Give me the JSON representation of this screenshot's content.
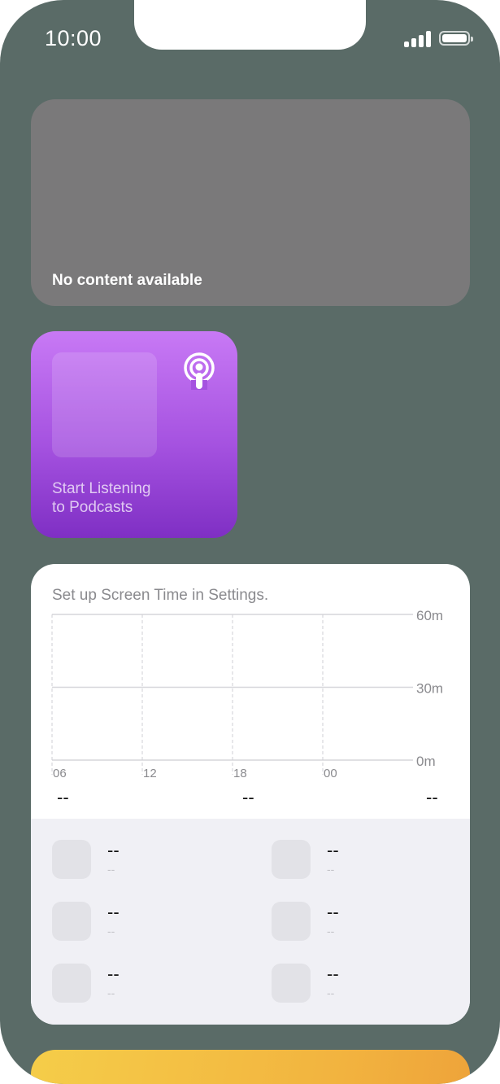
{
  "status_bar": {
    "time": "10:00"
  },
  "widgets": {
    "empty": {
      "message": "No content available"
    },
    "podcasts": {
      "line1": "Start Listening",
      "line2": "to Podcasts",
      "icon": "podcasts-icon"
    },
    "screen_time": {
      "hint": "Set up Screen Time in Settings.",
      "chart_data": {
        "type": "bar",
        "categories": [
          "06",
          "12",
          "18",
          "00"
        ],
        "values": [],
        "y_ticks": [
          "60m",
          "30m",
          "0m"
        ],
        "ylim": [
          0,
          60
        ],
        "grid": true
      },
      "summary": [
        "--",
        "--",
        "--"
      ],
      "apps": [
        {
          "name": "--",
          "time": "--"
        },
        {
          "name": "--",
          "time": "--"
        },
        {
          "name": "--",
          "time": "--"
        },
        {
          "name": "--",
          "time": "--"
        },
        {
          "name": "--",
          "time": "--"
        },
        {
          "name": "--",
          "time": "--"
        }
      ]
    }
  },
  "colors": {
    "wallpaper": "#5a6b67",
    "empty_widget": "#7a797a",
    "podcast_top": "#c879f5",
    "podcast_bottom": "#7f2fc4",
    "bottom_widget": "#f2b33f"
  }
}
